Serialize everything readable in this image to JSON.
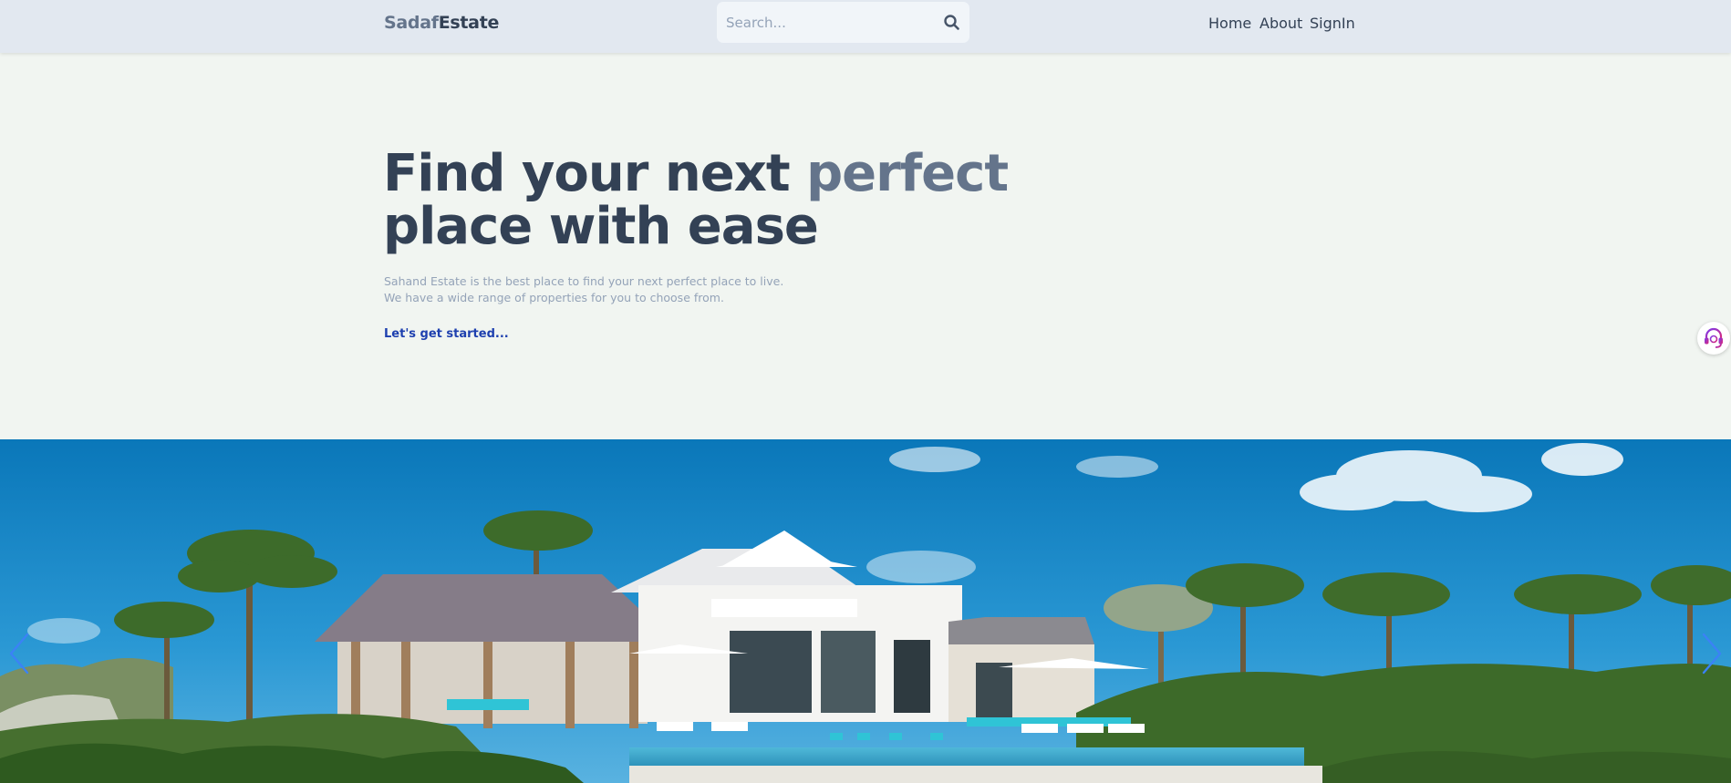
{
  "header": {
    "logo_part1": "Sadaf",
    "logo_part2": "Estate",
    "search_placeholder": "Search...",
    "nav": [
      "Home",
      "About",
      "SignIn"
    ]
  },
  "hero": {
    "title_line1_a": "Find your next ",
    "title_line1_b": "perfect",
    "title_line2": "place with ease",
    "desc_line1": "Sahand Estate is the best place to find your next perfect place to live.",
    "desc_line2": "We have a wide range of properties for you to choose from.",
    "cta": "Let's get started..."
  },
  "banner": {
    "prev_icon": "chevron-left-icon",
    "next_icon": "chevron-right-icon"
  },
  "widgets": {
    "support_icon": "headset-icon"
  },
  "colors": {
    "header_bg": "#e2e8f0",
    "page_bg": "#f1f5f1",
    "text_dark": "#334155",
    "text_muted": "#64748b",
    "link": "#1e40af",
    "arrow": "#3b82f6"
  }
}
